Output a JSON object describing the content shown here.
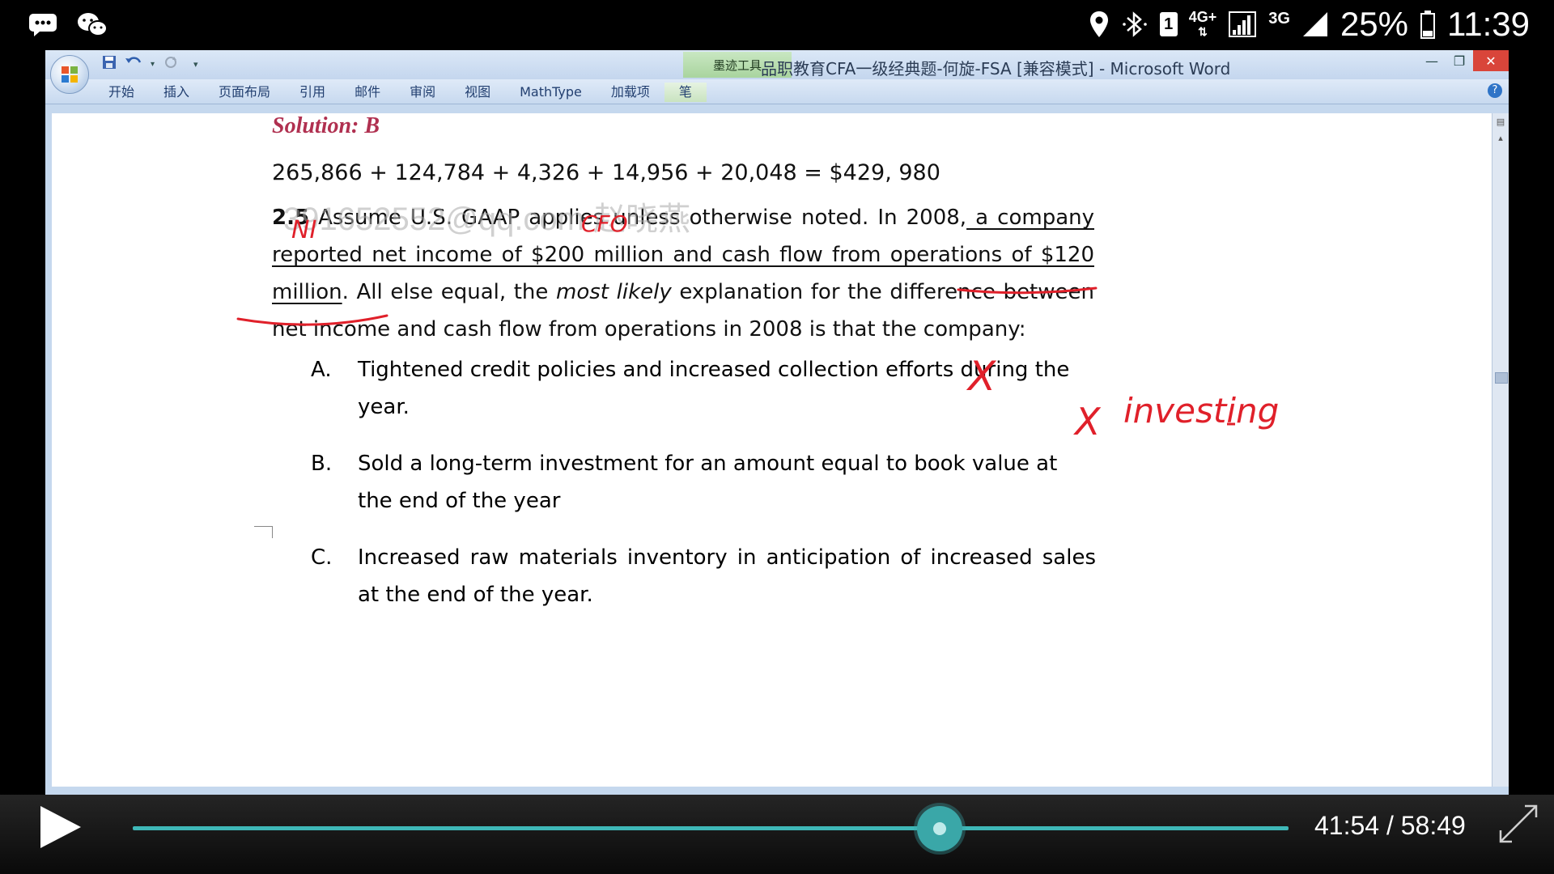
{
  "status_bar": {
    "network_primary": "4G+",
    "network_secondary": "3G",
    "battery": "25%",
    "time": "11:39",
    "sim_badge": "1"
  },
  "word": {
    "quick_access_icons": [
      "save-icon",
      "undo-icon",
      "redo-icon",
      "customize-icon"
    ],
    "contextual_tab": "墨迹工具",
    "window_title": "品职教育CFA一级经典题-何旋-FSA [兼容模式] - Microsoft Word",
    "ribbon_tabs": [
      "开始",
      "插入",
      "页面布局",
      "引用",
      "邮件",
      "审阅",
      "视图",
      "MathType",
      "加载项",
      "笔"
    ]
  },
  "document": {
    "solution": "Solution: B",
    "formula": "265,866 + 124,784 + 4,326 + 14,956 + 20,048 = $429, 980",
    "question": {
      "number": "2.5",
      "text_1": " Assume U.S. GAAP applies unless otherwise noted. In 2008,",
      "underlined_1": " a company reported net income of $200 million and cash flow from operations of $120 million",
      "text_2": ". All else equal, the ",
      "italic_1": "most likely",
      "text_3": " explanation for the difference between net income and cash flow from operations in 2008 is that the company:"
    },
    "options": [
      {
        "letter": "A.",
        "text": "Tightened credit policies and increased collection efforts during the year."
      },
      {
        "letter": "B.",
        "text": "Sold a long-term investment for an amount equal to book value at the end of the year"
      },
      {
        "letter": "C.",
        "text": "Increased raw materials inventory in anticipation of increased sales at the end of the year."
      }
    ],
    "watermark": "391652552@qq.com 赵晓燕",
    "annotations": {
      "ni": "NI",
      "cfo": "CFO",
      "mark_a": "X",
      "mark_b": "X",
      "investing": "investing"
    }
  },
  "player": {
    "current_time": "41:54",
    "separator": "/",
    "duration": "58:49",
    "progress": 0.698
  },
  "colors": {
    "accent": "#3aa7a8",
    "ink": "#e0202a",
    "solution": "#b03050"
  }
}
